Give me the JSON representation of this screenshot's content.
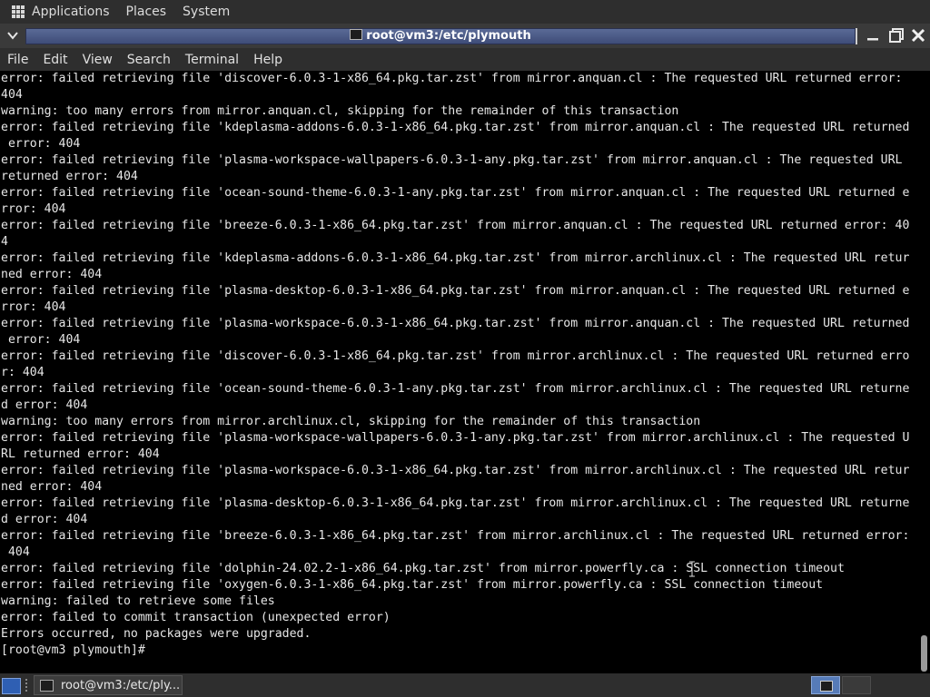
{
  "top_panel": {
    "menus": [
      "Applications",
      "Places",
      "System"
    ]
  },
  "window": {
    "title": "root@vm3:/etc/plymouth"
  },
  "terminal_menu": [
    "File",
    "Edit",
    "View",
    "Search",
    "Terminal",
    "Help"
  ],
  "terminal": {
    "lines": [
      "error: failed retrieving file 'discover-6.0.3-1-x86_64.pkg.tar.zst' from mirror.anquan.cl : The requested URL returned error:",
      "404",
      "warning: too many errors from mirror.anquan.cl, skipping for the remainder of this transaction",
      "error: failed retrieving file 'kdeplasma-addons-6.0.3-1-x86_64.pkg.tar.zst' from mirror.anquan.cl : The requested URL returned",
      " error: 404",
      "error: failed retrieving file 'plasma-workspace-wallpapers-6.0.3-1-any.pkg.tar.zst' from mirror.anquan.cl : The requested URL",
      "returned error: 404",
      "error: failed retrieving file 'ocean-sound-theme-6.0.3-1-any.pkg.tar.zst' from mirror.anquan.cl : The requested URL returned e",
      "rror: 404",
      "error: failed retrieving file 'breeze-6.0.3-1-x86_64.pkg.tar.zst' from mirror.anquan.cl : The requested URL returned error: 40",
      "4",
      "error: failed retrieving file 'kdeplasma-addons-6.0.3-1-x86_64.pkg.tar.zst' from mirror.archlinux.cl : The requested URL retur",
      "ned error: 404",
      "error: failed retrieving file 'plasma-desktop-6.0.3-1-x86_64.pkg.tar.zst' from mirror.anquan.cl : The requested URL returned e",
      "rror: 404",
      "error: failed retrieving file 'plasma-workspace-6.0.3-1-x86_64.pkg.tar.zst' from mirror.anquan.cl : The requested URL returned",
      " error: 404",
      "error: failed retrieving file 'discover-6.0.3-1-x86_64.pkg.tar.zst' from mirror.archlinux.cl : The requested URL returned erro",
      "r: 404",
      "error: failed retrieving file 'ocean-sound-theme-6.0.3-1-any.pkg.tar.zst' from mirror.archlinux.cl : The requested URL returne",
      "d error: 404",
      "warning: too many errors from mirror.archlinux.cl, skipping for the remainder of this transaction",
      "error: failed retrieving file 'plasma-workspace-wallpapers-6.0.3-1-any.pkg.tar.zst' from mirror.archlinux.cl : The requested U",
      "RL returned error: 404",
      "error: failed retrieving file 'plasma-workspace-6.0.3-1-x86_64.pkg.tar.zst' from mirror.archlinux.cl : The requested URL retur",
      "ned error: 404",
      "error: failed retrieving file 'plasma-desktop-6.0.3-1-x86_64.pkg.tar.zst' from mirror.archlinux.cl : The requested URL returne",
      "d error: 404",
      "error: failed retrieving file 'breeze-6.0.3-1-x86_64.pkg.tar.zst' from mirror.archlinux.cl : The requested URL returned error:",
      " 404",
      "error: failed retrieving file 'dolphin-24.02.2-1-x86_64.pkg.tar.zst' from mirror.powerfly.ca : SSL connection timeout",
      "error: failed retrieving file 'oxygen-6.0.3-1-x86_64.pkg.tar.zst' from mirror.powerfly.ca : SSL connection timeout",
      "warning: failed to retrieve some files",
      "error: failed to commit transaction (unexpected error)",
      "Errors occurred, no packages were upgraded.",
      "[root@vm3 plymouth]# "
    ]
  },
  "taskbar": {
    "task_label": "root@vm3:/etc/ply..."
  }
}
